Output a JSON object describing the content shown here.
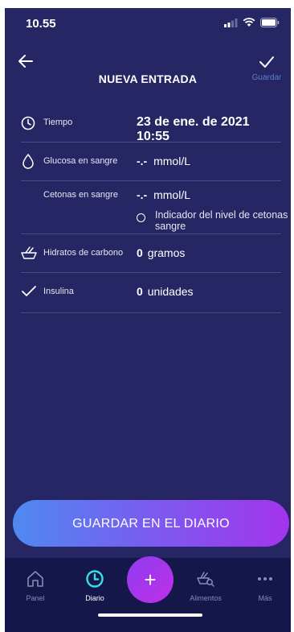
{
  "status_bar": {
    "time": "10.55"
  },
  "header": {
    "title": "NUEVA ENTRADA",
    "save_label": "Guardar"
  },
  "form": {
    "time": {
      "label": "Tiempo",
      "value": "23 de ene. de 2021 10:55"
    },
    "glucose": {
      "label": "Glucosa en sangre",
      "value": "-.-",
      "unit": "mmol/L"
    },
    "ketones": {
      "label": "Cetonas en sangre",
      "value": "-.-",
      "unit": "mmol/L",
      "indicator_label": "Indicador del nivel de cetonas en sangre"
    },
    "carbs": {
      "label": "Hidratos de carbono",
      "value": "0",
      "unit": "gramos"
    },
    "insulin": {
      "label": "Insulina",
      "value": "0",
      "unit": "unidades"
    }
  },
  "main_button": {
    "label": "GUARDAR EN EL DIARIO"
  },
  "tab_bar": {
    "items": [
      {
        "label": "Panel",
        "icon": "home-icon"
      },
      {
        "label": "Diario",
        "icon": "clock-icon"
      },
      {
        "label": "+",
        "icon": "plus-icon"
      },
      {
        "label": "Alimentos",
        "icon": "food-search-icon"
      },
      {
        "label": "Más",
        "icon": "more-icon"
      }
    ]
  },
  "colors": {
    "background": "#252663",
    "tab_bar": "#15164a",
    "accent_blue": "#5d7fd6",
    "gradient_start": "#4f89f0",
    "gradient_end": "#a334ec"
  }
}
